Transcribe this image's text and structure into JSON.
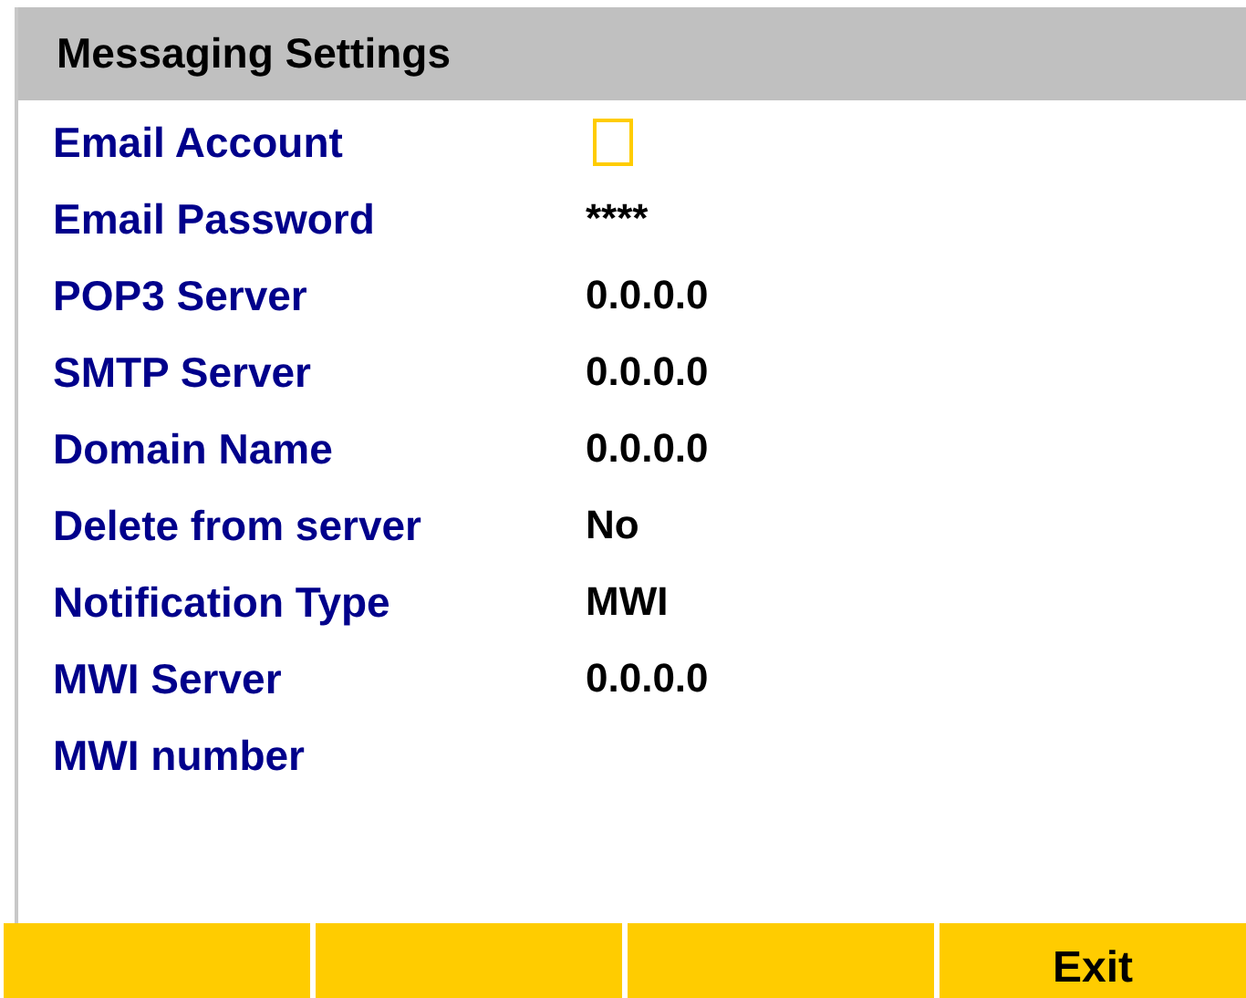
{
  "header": {
    "title": "Messaging Settings"
  },
  "settings": [
    {
      "label": "Email Account",
      "kind": "field",
      "focused": true
    },
    {
      "label": "Email Password",
      "kind": "text",
      "value": "****"
    },
    {
      "label": "POP3 Server",
      "kind": "text",
      "value": "0.0.0.0"
    },
    {
      "label": "SMTP Server",
      "kind": "text",
      "value": "0.0.0.0"
    },
    {
      "label": "Domain Name",
      "kind": "text",
      "value": "0.0.0.0"
    },
    {
      "label": "Delete from server",
      "kind": "text",
      "value": "No"
    },
    {
      "label": "Notification Type",
      "kind": "text",
      "value": "MWI"
    },
    {
      "label": "MWI Server",
      "kind": "text",
      "value": "0.0.0.0"
    },
    {
      "label": "MWI number",
      "kind": "text"
    }
  ],
  "softkeys": [
    {
      "kind": "blank"
    },
    {
      "kind": "blank"
    },
    {
      "kind": "blank"
    },
    {
      "kind": "label",
      "label": "Exit"
    }
  ]
}
